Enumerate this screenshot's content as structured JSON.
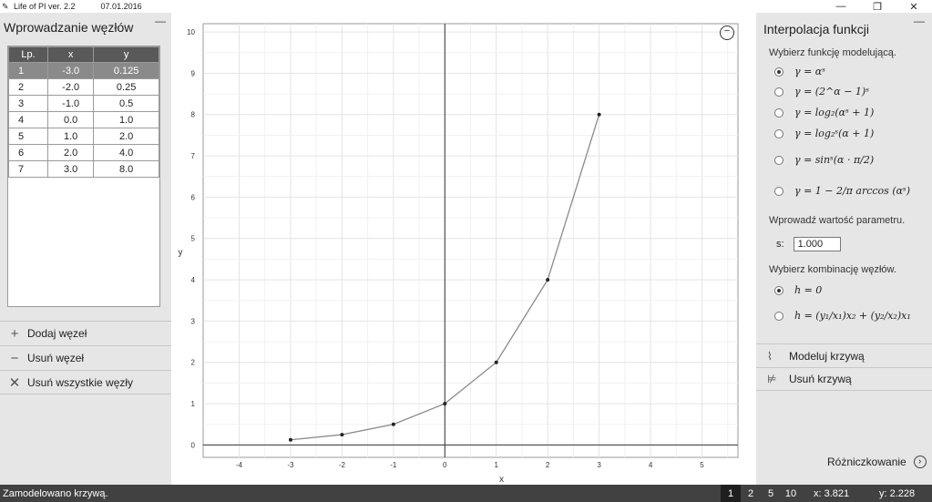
{
  "window": {
    "title": "Life of PI ver. 2.2",
    "date": "07.01.2016",
    "controls": [
      "—",
      "❐",
      "✕"
    ]
  },
  "left_panel": {
    "title": "Wprowadzanie węzłów",
    "minimize": "—",
    "table": {
      "headers": [
        "Lp.",
        "x",
        "y"
      ],
      "rows": [
        [
          "1",
          "-3.0",
          "0.125"
        ],
        [
          "2",
          "-2.0",
          "0.25"
        ],
        [
          "3",
          "-1.0",
          "0.5"
        ],
        [
          "4",
          "0.0",
          "1.0"
        ],
        [
          "5",
          "1.0",
          "2.0"
        ],
        [
          "6",
          "2.0",
          "4.0"
        ],
        [
          "7",
          "3.0",
          "8.0"
        ]
      ],
      "selected_row": 0
    },
    "buttons": {
      "add": "Dodaj węzeł",
      "remove": "Usuń węzeł",
      "remove_all": "Usuń wszystkie węzły"
    }
  },
  "chart_data": {
    "type": "line",
    "xlabel": "x",
    "ylabel": "y",
    "xlim": [
      -4.7,
      5.7
    ],
    "ylim": [
      -0.3,
      10.2
    ],
    "xticks": [
      -4,
      -3,
      -2,
      -1,
      0,
      1,
      2,
      3,
      4,
      5
    ],
    "yticks": [
      0,
      1,
      2,
      3,
      4,
      5,
      6,
      7,
      8,
      9,
      10
    ],
    "grid": true,
    "series": [
      {
        "x": [
          -3,
          -2,
          -1,
          0,
          1,
          2,
          3
        ],
        "y": [
          0.125,
          0.25,
          0.5,
          1,
          2,
          4,
          8
        ]
      }
    ]
  },
  "right_panel": {
    "title": "Interpolacja funkcji",
    "minimize": "—",
    "choose_function_label": "Wybierz funkcję modelującą.",
    "functions": [
      {
        "formula": "γ = αˢ",
        "checked": true
      },
      {
        "formula": "γ = (2^α − 1)ˢ",
        "checked": false
      },
      {
        "formula": "γ = log₂(αˢ + 1)",
        "checked": false
      },
      {
        "formula": "γ = log₂ˢ(α + 1)",
        "checked": false
      },
      {
        "formula": "γ = sinˢ(α · π/2)",
        "checked": false
      },
      {
        "formula": "γ = 1 − 2/π arccos (αˢ)",
        "checked": false
      }
    ],
    "param_label": "Wprowadź wartość parametru.",
    "param_name": "s:",
    "param_value": "1.000",
    "combination_label": "Wybierz kombinację węzłów.",
    "combinations": [
      {
        "formula": "h = 0",
        "checked": true
      },
      {
        "formula": "h = (y₁/x₁)x₂ + (y₂/x₂)x₁",
        "checked": false
      }
    ],
    "model_button": "Modeluj krzywą",
    "remove_curve_button": "Usuń krzywą",
    "differentiate_link": "Różniczkowanie"
  },
  "status": {
    "message": "Zamodelowano krzywą.",
    "pages": [
      "1",
      "2",
      "5",
      "10"
    ],
    "active_page": 0,
    "x_readout": "x: 3.821",
    "y_readout": "y: 2.228"
  }
}
